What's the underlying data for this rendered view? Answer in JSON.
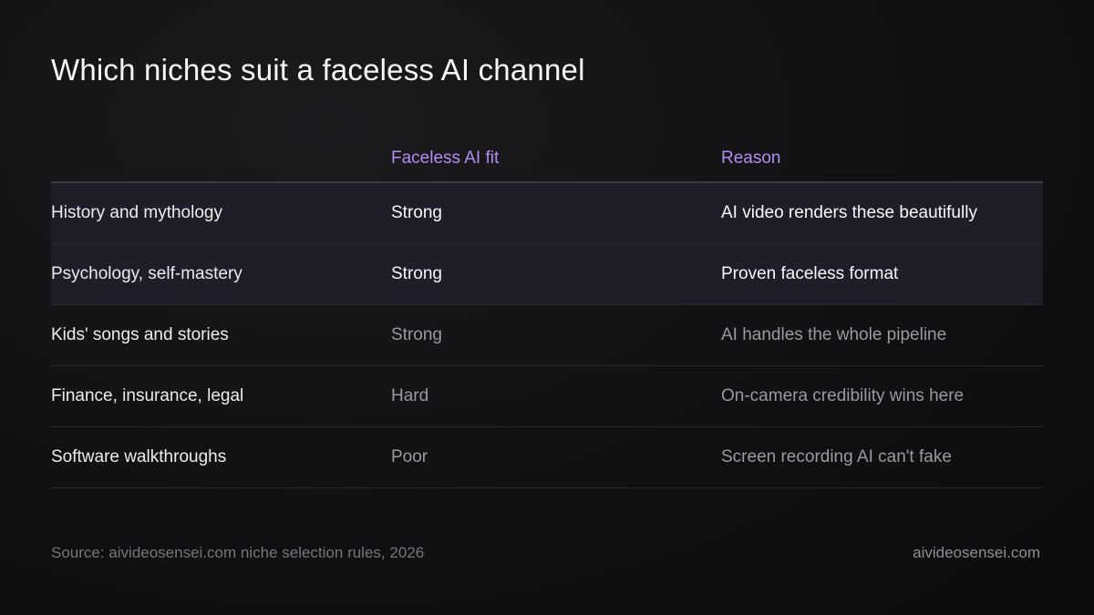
{
  "title": "Which niches suit a faceless AI channel",
  "table": {
    "headers": {
      "niche": "",
      "fit": "Faceless AI fit",
      "reason": "Reason"
    },
    "rows": [
      {
        "niche": "History and mythology",
        "fit": "Strong",
        "reason": "AI video renders these beautifully",
        "highlighted": true
      },
      {
        "niche": "Psychology, self-mastery",
        "fit": "Strong",
        "reason": "Proven faceless format",
        "highlighted": true
      },
      {
        "niche": "Kids' songs and stories",
        "fit": "Strong",
        "reason": "AI handles the whole pipeline",
        "highlighted": false
      },
      {
        "niche": "Finance, insurance, legal",
        "fit": "Hard",
        "reason": "On-camera credibility wins here",
        "highlighted": false
      },
      {
        "niche": "Software walkthroughs",
        "fit": "Poor",
        "reason": "Screen recording AI can't fake",
        "highlighted": false
      }
    ]
  },
  "footer": {
    "source": "Source: aivideosensei.com niche selection rules, 2026",
    "site": "aivideosensei.com"
  },
  "colors": {
    "accent": "#b28cf0",
    "highlight_row": "#1e1d28",
    "background": "#111113"
  }
}
